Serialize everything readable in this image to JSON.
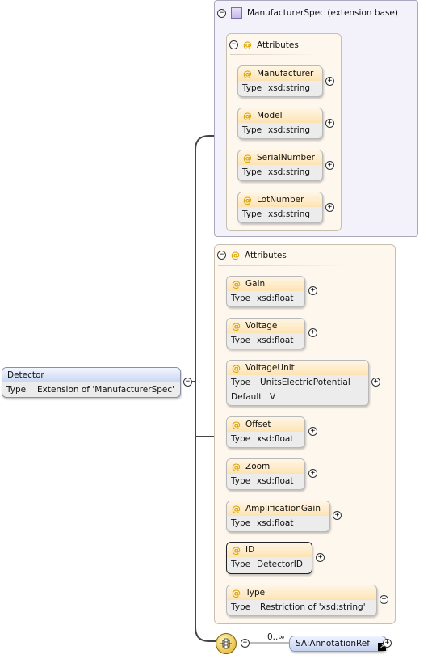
{
  "extension": {
    "title": "ManufacturerSpec (extension base)",
    "attributes_label": "Attributes",
    "items": [
      {
        "name": "Manufacturer",
        "type_key": "Type",
        "type": "xsd:string"
      },
      {
        "name": "Model",
        "type_key": "Type",
        "type": "xsd:string"
      },
      {
        "name": "SerialNumber",
        "type_key": "Type",
        "type": "xsd:string"
      },
      {
        "name": "LotNumber",
        "type_key": "Type",
        "type": "xsd:string"
      }
    ]
  },
  "attributes": {
    "label": "Attributes",
    "items": [
      {
        "name": "Gain",
        "type_key": "Type",
        "type": "xsd:float"
      },
      {
        "name": "Voltage",
        "type_key": "Type",
        "type": "xsd:float"
      },
      {
        "name": "VoltageUnit",
        "type_key": "Type",
        "type": "UnitsElectricPotential",
        "default_key": "Default",
        "default": "V"
      },
      {
        "name": "Offset",
        "type_key": "Type",
        "type": "xsd:float"
      },
      {
        "name": "Zoom",
        "type_key": "Type",
        "type": "xsd:float"
      },
      {
        "name": "AmplificationGain",
        "type_key": "Type",
        "type": "xsd:float"
      },
      {
        "name": "ID",
        "type_key": "Type",
        "type": "DetectorID"
      },
      {
        "name": "Type",
        "type_key": "Type",
        "type": "Restriction of 'xsd:string'"
      }
    ]
  },
  "detector": {
    "name": "Detector",
    "type_key": "Type",
    "type": "Extension of 'ManufacturerSpec'"
  },
  "annotation": {
    "cardinality": "0..∞",
    "ref": "SA:AnnotationRef"
  },
  "glyphs": {
    "at": "@",
    "minus": "−",
    "plus": "+",
    "link": "↗"
  },
  "colors": {
    "attribute_header": "#fde3b3",
    "element_header": "#c9d6f2",
    "extension_bg": "#f3f1fa"
  },
  "icons": [
    "collapse-icon",
    "expand-icon",
    "attribute-icon",
    "complex-type-icon",
    "sequence-icon",
    "reference-link-icon"
  ]
}
